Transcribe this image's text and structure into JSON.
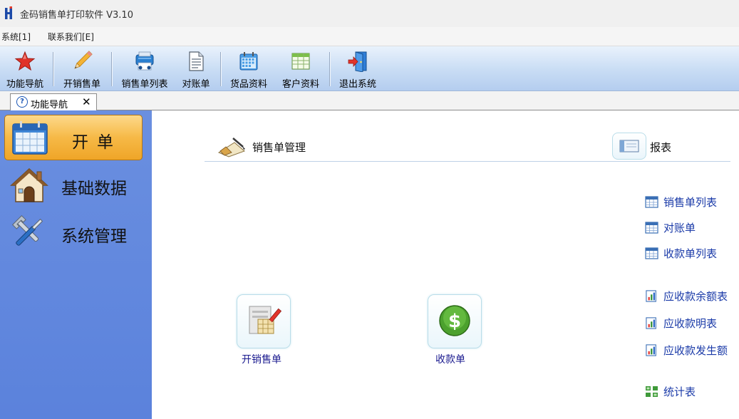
{
  "window": {
    "title": "金码销售单打印软件 V3.10"
  },
  "menu": {
    "items": [
      "系统[1]",
      "联系我们[E]"
    ]
  },
  "toolbar": {
    "items": [
      {
        "label": "功能导航",
        "icon": "star-icon"
      },
      {
        "label": "开销售单",
        "icon": "pencil-icon"
      },
      {
        "label": "销售单列表",
        "icon": "printer-icon"
      },
      {
        "label": "对账单",
        "icon": "document-icon"
      },
      {
        "label": "货品资料",
        "icon": "calendar-icon"
      },
      {
        "label": "客户资料",
        "icon": "spreadsheet-icon"
      },
      {
        "label": "退出系统",
        "icon": "exit-door-icon"
      }
    ]
  },
  "tabs": [
    {
      "label": "功能导航",
      "close": "✕"
    }
  ],
  "sidebar": {
    "items": [
      {
        "label": "开单",
        "icon": "calendar-icon",
        "active": true
      },
      {
        "label": "基础数据",
        "icon": "house-icon",
        "active": false
      },
      {
        "label": "系统管理",
        "icon": "tools-icon",
        "active": false
      }
    ]
  },
  "main": {
    "sales_section": {
      "title": "销售单管理"
    },
    "report_section": {
      "title": "报表"
    },
    "actions": [
      {
        "label": "开销售单",
        "icon": "invoice-icon"
      },
      {
        "label": "收款单",
        "icon": "dollar-coin-icon"
      }
    ],
    "report_links": [
      {
        "label": "销售单列表",
        "icon": "table-icon"
      },
      {
        "label": "对账单",
        "icon": "table-icon"
      },
      {
        "label": "收款单列表",
        "icon": "table-icon"
      },
      {
        "label": "应收款余额表",
        "icon": "bar-chart-icon"
      },
      {
        "label": "应收款明表",
        "icon": "bar-chart-icon"
      },
      {
        "label": "应收款发生额",
        "icon": "bar-chart-icon"
      },
      {
        "label": "统计表",
        "icon": "grid-icon"
      }
    ]
  }
}
